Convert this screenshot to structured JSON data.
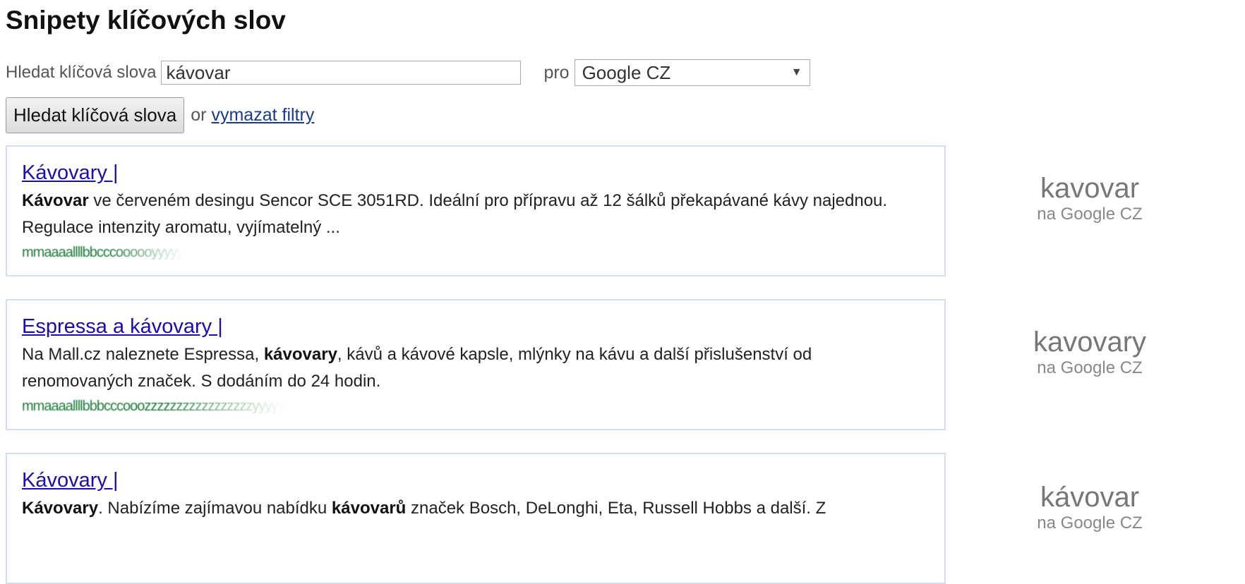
{
  "page": {
    "title": "Snipety klíčových slov"
  },
  "search": {
    "label": "Hledat klíčová slova",
    "value": "kávovar",
    "for_label": "pro",
    "engine_selected": "Google CZ",
    "button_label": "Hledat klíčová slova",
    "or_text": "or",
    "clear_link": "vymazat filtry"
  },
  "results": [
    {
      "title": "Kávovary |",
      "desc_parts": [
        {
          "text": "Kávovar",
          "bold": true
        },
        {
          "text": " ve červeném desingu Sencor SCE 3051RD. Ideální pro přípravu až 12 šálků překapávané kávy najednou. Regulace intenzity aromatu, vyjímatelný ...",
          "bold": false
        }
      ],
      "url": "mmaaaallllbbcccoooooyyyyy",
      "keyword": "kavovar",
      "engine": "na Google CZ"
    },
    {
      "title": "Espressa a kávovary |",
      "desc_parts": [
        {
          "text": "Na Mall.cz naleznete Espressa, ",
          "bold": false
        },
        {
          "text": "kávovary",
          "bold": true
        },
        {
          "text": ", kávů a kávové kapsle, mlýnky na kávu a další přislušenství od renomovaných značek. S dodáním do 24 hodin.",
          "bold": false
        }
      ],
      "url": "mmaaaallllbbbcccooozzzzzzzzzzzzzzzzzyyyyy",
      "keyword": "kavovary",
      "engine": "na Google CZ"
    },
    {
      "title": "Kávovary |",
      "desc_parts": [
        {
          "text": "Kávovary",
          "bold": true
        },
        {
          "text": ". Nabízíme zajímavou nabídku ",
          "bold": false
        },
        {
          "text": "kávovarů",
          "bold": true
        },
        {
          "text": " značek Bosch, DeLonghi, Eta, Russell Hobbs a další. Z",
          "bold": false
        }
      ],
      "url": "",
      "keyword": "kávovar",
      "engine": "na Google CZ"
    }
  ],
  "colors": {
    "link": "#1a0dab",
    "url_green": "#1e7a3a",
    "card_border": "#d3def2",
    "side_text": "#777777"
  }
}
